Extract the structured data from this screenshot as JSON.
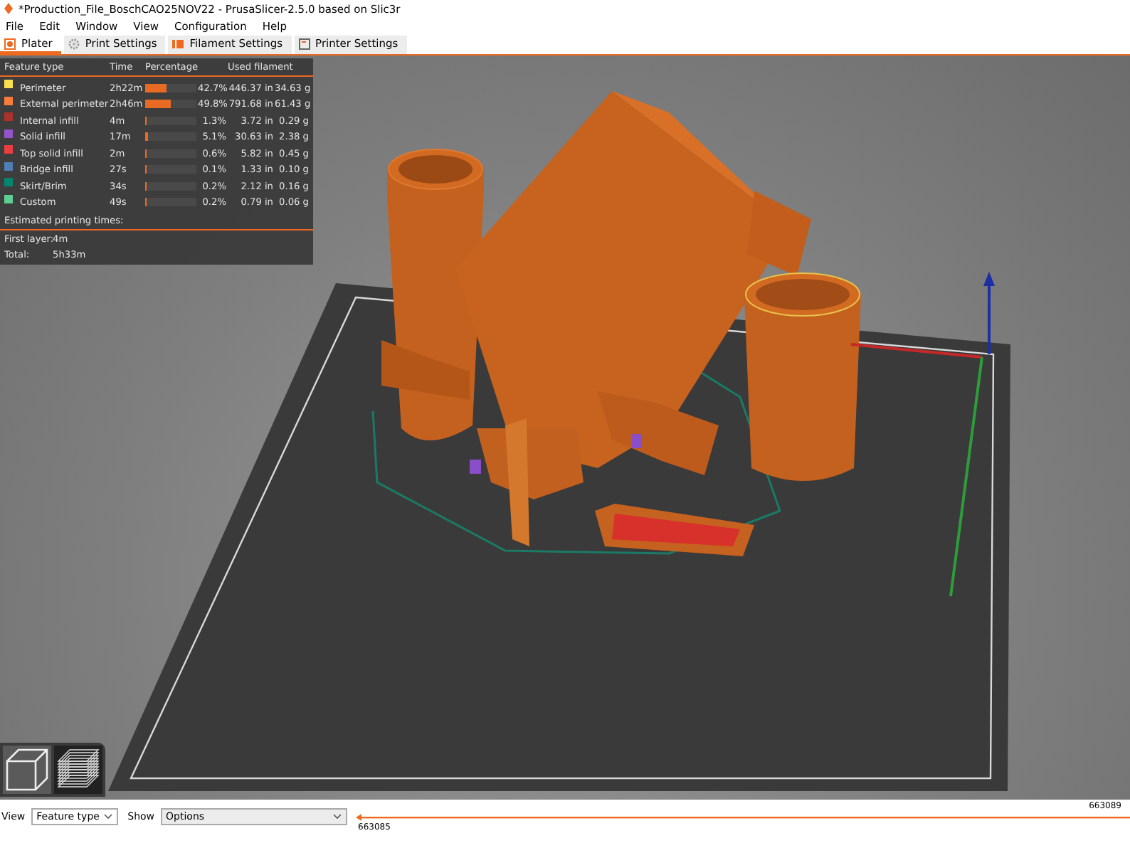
{
  "window": {
    "title": "*Production_File_BoschCAO25NOV22 - PrusaSlicer-2.5.0 based on Slic3r"
  },
  "menu": [
    "File",
    "Edit",
    "Window",
    "View",
    "Configuration",
    "Help"
  ],
  "tabs": [
    {
      "label": "Plater",
      "kind": "plater",
      "selected": true
    },
    {
      "label": "Print Settings",
      "kind": "print",
      "selected": false
    },
    {
      "label": "Filament Settings",
      "kind": "filament",
      "selected": false
    },
    {
      "label": "Printer Settings",
      "kind": "printer",
      "selected": false
    }
  ],
  "legend": {
    "columns": [
      "Feature type",
      "Time",
      "Percentage",
      "Used filament"
    ],
    "rows": [
      {
        "name": "Perimeter",
        "color": "#ffe64d",
        "time": "2h22m",
        "level": 0.427,
        "percentage": "42.7%",
        "length": "446.37 in",
        "weight": "34.63 g"
      },
      {
        "name": "External perimeter",
        "color": "#ff7d38",
        "time": "2h46m",
        "level": 0.498,
        "percentage": "49.8%",
        "length": "791.68 in",
        "weight": "61.43 g"
      },
      {
        "name": "Internal infill",
        "color": "#b03029",
        "time": "4m",
        "level": 0.013,
        "percentage": "1.3%",
        "length": "3.72 in",
        "weight": "0.29 g"
      },
      {
        "name": "Solid infill",
        "color": "#9654cc",
        "time": "17m",
        "level": 0.051,
        "percentage": "5.1%",
        "length": "30.63 in",
        "weight": "2.38 g"
      },
      {
        "name": "Top solid infill",
        "color": "#f03d3d",
        "time": "2m",
        "level": 0.006,
        "percentage": "0.6%",
        "length": "5.82 in",
        "weight": "0.45 g"
      },
      {
        "name": "Bridge infill",
        "color": "#4d80ba",
        "time": "27s",
        "level": 0.001,
        "percentage": "0.1%",
        "length": "1.33 in",
        "weight": "0.10 g"
      },
      {
        "name": "Skirt/Brim",
        "color": "#00876e",
        "time": "34s",
        "level": 0.002,
        "percentage": "0.2%",
        "length": "2.12 in",
        "weight": "0.16 g"
      },
      {
        "name": "Custom",
        "color": "#5ed194",
        "time": "49s",
        "level": 0.002,
        "percentage": "0.2%",
        "length": "0.79 in",
        "weight": "0.06 g"
      }
    ],
    "estimate_heading": "Estimated printing times:",
    "estimates": [
      {
        "label": "First layer:",
        "value": "4m"
      },
      {
        "label": "Total:",
        "value": "5h33m"
      }
    ]
  },
  "bottom_bar": {
    "view_label": "View",
    "view_value": "Feature type",
    "show_label": "Show",
    "show_value": "Options",
    "slider_low": "663085",
    "slider_high": "663089"
  }
}
